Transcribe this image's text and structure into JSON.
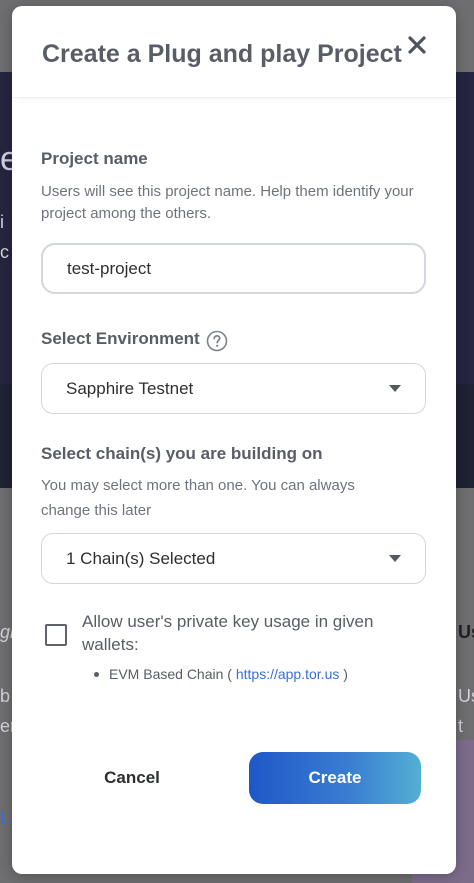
{
  "background": {
    "fragments": [
      "e",
      "i",
      "c",
      "gi",
      "b",
      "er",
      "Us",
      "Us",
      "t",
      "Le"
    ]
  },
  "modal": {
    "title": "Create a Plug and play Project",
    "close_label": "×"
  },
  "project_name": {
    "label": "Project name",
    "help": "Users will see this project name. Help them identify your project among the others.",
    "value": "test-project"
  },
  "environment": {
    "label": "Select Environment",
    "selected": "Sapphire Testnet"
  },
  "chains": {
    "label": "Select chain(s) you are building on",
    "help": "You may select more than one. You can always change this later",
    "selected": "1 Chain(s) Selected"
  },
  "private_key": {
    "label": "Allow user's private key usage in given wallets:",
    "checked": false,
    "bullet_prefix": "EVM Based Chain (",
    "bullet_link": "https://app.tor.us",
    "bullet_suffix": ")"
  },
  "actions": {
    "cancel": "Cancel",
    "create": "Create"
  },
  "colors": {
    "primary_gradient_start": "#1f57c9",
    "primary_gradient_end": "#53b0d4",
    "text_heading": "#595d66",
    "link": "#3a6fd8"
  }
}
